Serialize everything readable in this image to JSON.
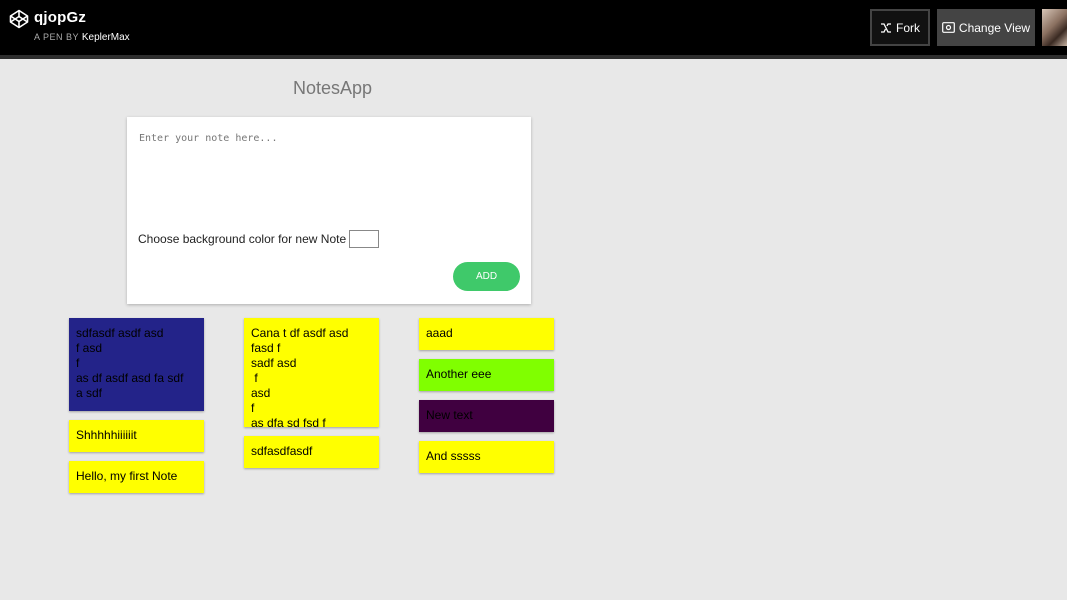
{
  "header": {
    "pen_title": "qjopGz",
    "pen_by_label": "A PEN BY",
    "author": "KeplerMax",
    "fork_label": "Fork",
    "change_view_label": "Change View"
  },
  "app": {
    "title": "NotesApp",
    "input_placeholder": "Enter your note here...",
    "input_value": "",
    "color_label": "Choose background color for new Note",
    "selected_color": "#000000",
    "add_label": "ADD"
  },
  "notes": [
    {
      "text": "sdfasdf asdf asd\nf asd\nf\nas df asdf asd fa sdf\na sdf",
      "bg": "#232389"
    },
    {
      "text": "Shhhhhiiiiiit",
      "bg": "#ffff00"
    },
    {
      "text": "Hello, my first Note",
      "bg": "#ffff00"
    },
    {
      "text": "Cana t df asdf asd fasd f\nsadf asd\n f\nasd\nf\nas dfa sd fsd f",
      "bg": "#ffff00"
    },
    {
      "text": "sdfasdfasdf",
      "bg": "#ffff00"
    },
    {
      "text": "aaad",
      "bg": "#ffff00"
    },
    {
      "text": "Another eee",
      "bg": "#80ff00"
    },
    {
      "text": "New text",
      "bg": "#400040"
    },
    {
      "text": "And sssss",
      "bg": "#ffff00"
    }
  ]
}
